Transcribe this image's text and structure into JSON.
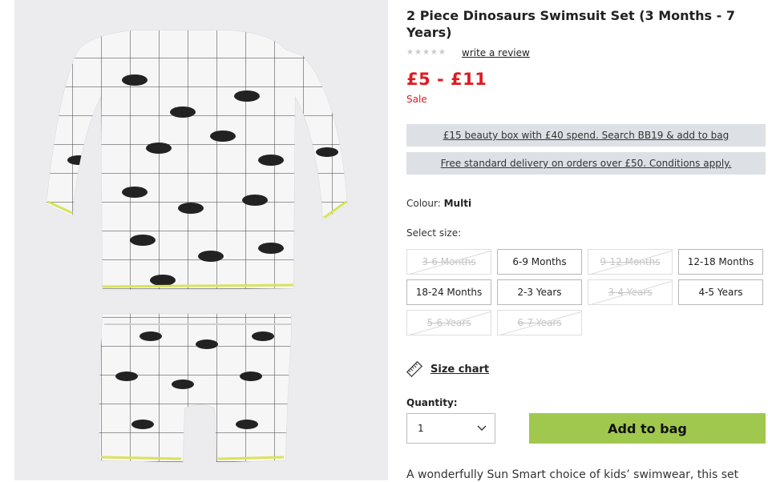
{
  "product": {
    "title": "2 Piece Dinosaurs Swimsuit Set (3 Months - 7 Years)",
    "image_alt": "2 Piece Dinosaurs Swimsuit Set",
    "rating": 0,
    "review_link": "write a review",
    "price": "£5 - £11",
    "sale_label": "Sale"
  },
  "promos": [
    "£15 beauty box with £40 spend. Search BB19 & add to bag",
    "Free standard delivery on orders over £50. Conditions apply."
  ],
  "colour": {
    "label": "Colour:",
    "value": "Multi"
  },
  "size_select": {
    "label": "Select size:",
    "options": [
      {
        "label": "3-6 Months",
        "available": false
      },
      {
        "label": "6-9 Months",
        "available": true
      },
      {
        "label": "9-12 Months",
        "available": false
      },
      {
        "label": "12-18 Months",
        "available": true
      },
      {
        "label": "18-24 Months",
        "available": true
      },
      {
        "label": "2-3 Years",
        "available": true
      },
      {
        "label": "3-4 Years",
        "available": false
      },
      {
        "label": "4-5 Years",
        "available": true
      },
      {
        "label": "5-6 Years",
        "available": false
      },
      {
        "label": "6-7 Years",
        "available": false
      }
    ]
  },
  "size_chart": {
    "label": "Size chart",
    "icon": "ruler-icon"
  },
  "quantity": {
    "label": "Quantity:",
    "value": "1"
  },
  "add_to_bag": "Add to bag",
  "description": "A wonderfully Sun Smart choice of kids’ swimwear, this set",
  "colors": {
    "price_red": "#e01a21",
    "add_bag_green": "#a1c84e",
    "promo_bg": "#dde1e5"
  }
}
